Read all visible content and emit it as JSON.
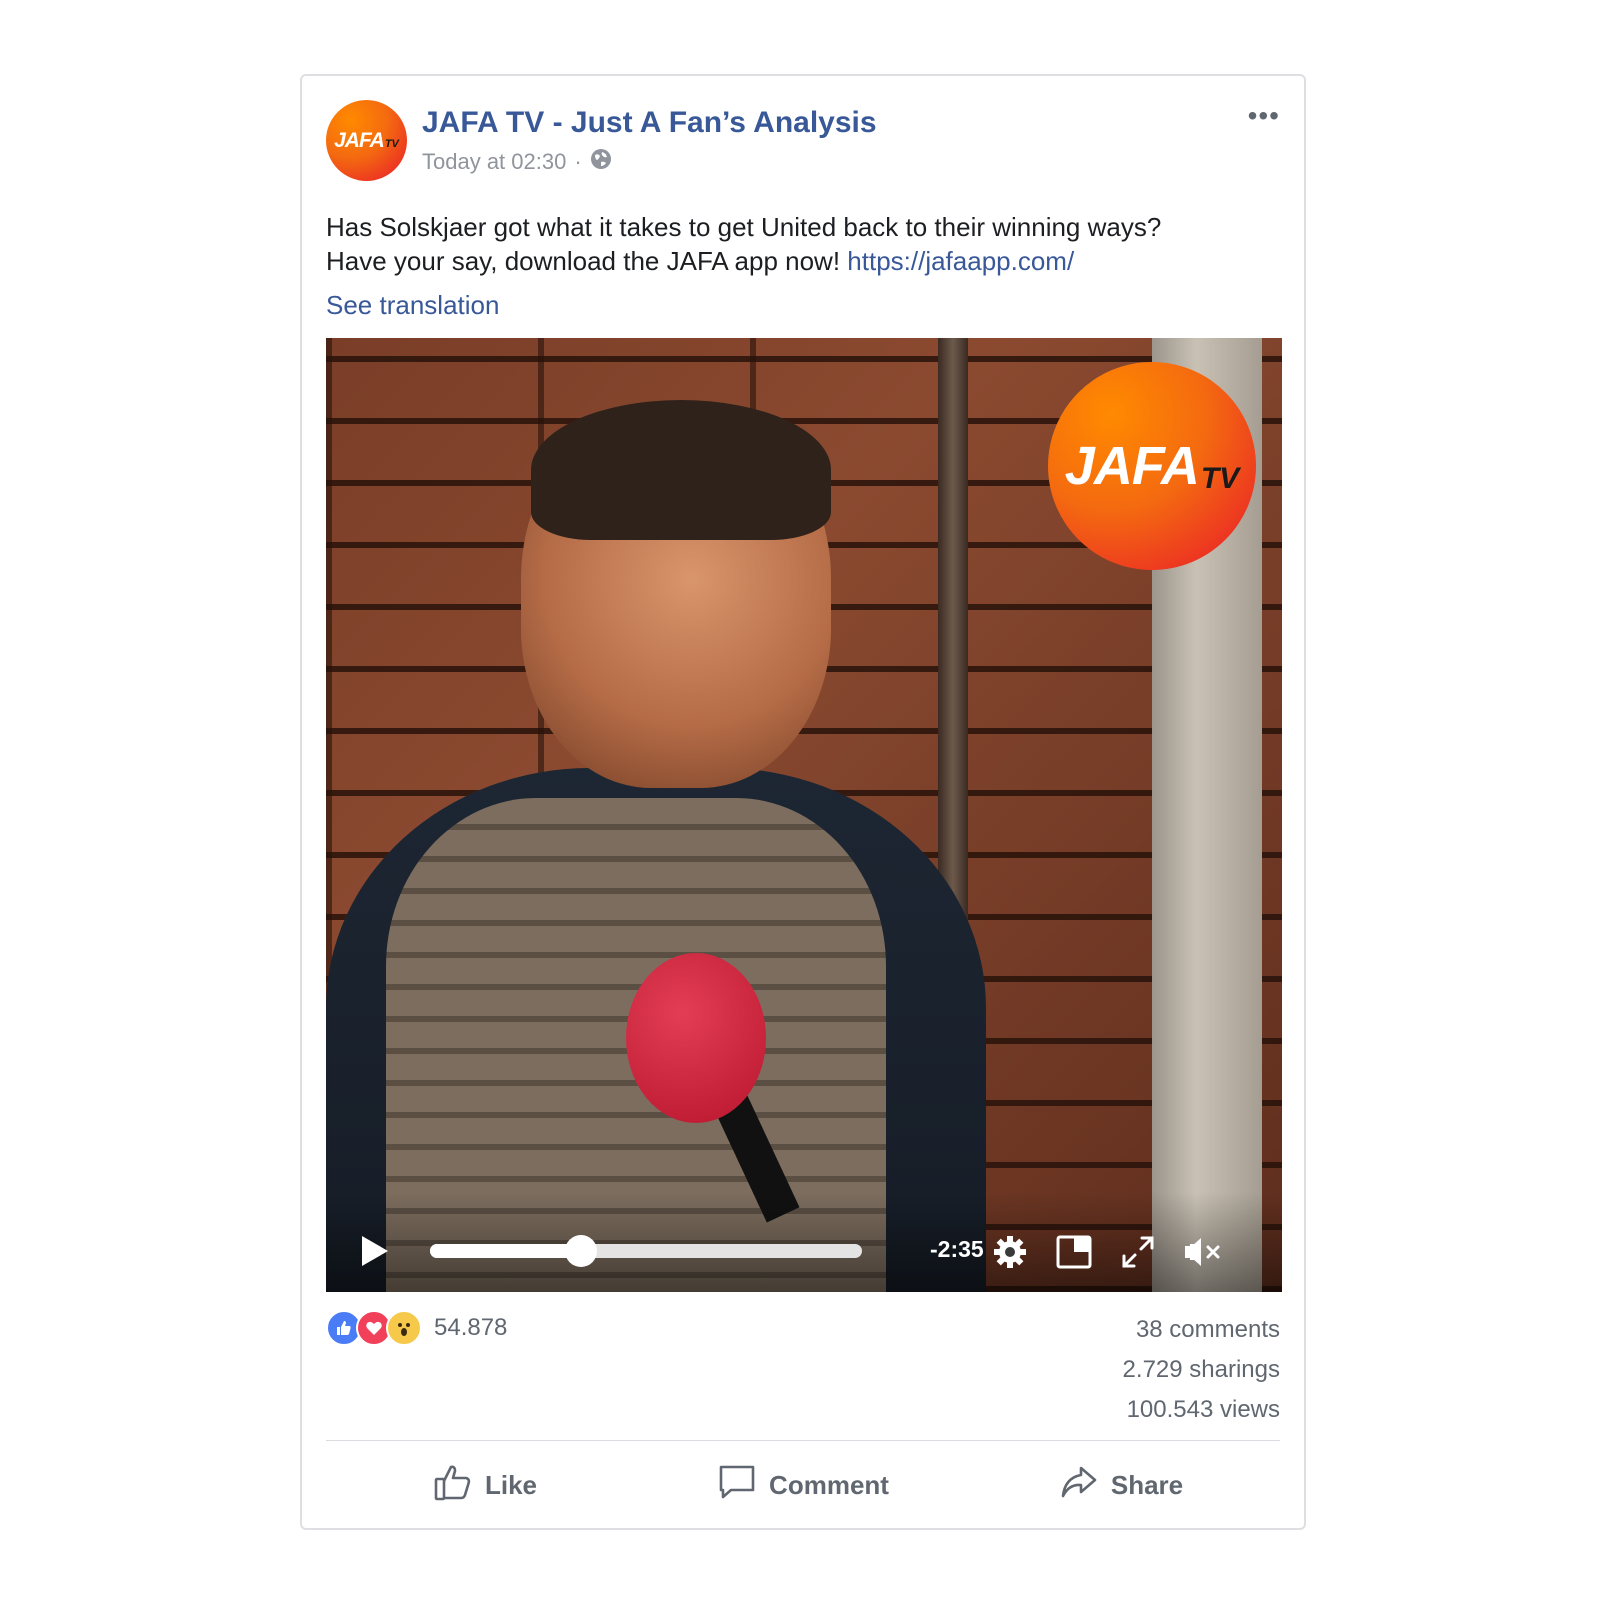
{
  "post": {
    "page_name": "JAFA TV - Just A Fan’s Analysis",
    "timestamp": "Today at 02:30",
    "meta_separator": "·",
    "more_label": "•••",
    "text_line1": "Has Solskjaer got what it takes to get United back to their winning ways?",
    "text_line2": "Have your say, download the JAFA app now!",
    "link": "https://jafaapp.com/",
    "see_translation": "See translation"
  },
  "logo": {
    "word": "JAFA",
    "tv": "TV"
  },
  "video": {
    "time_remaining": "-2:35",
    "progress_fraction": 0.35,
    "muted": true
  },
  "stats": {
    "reaction_count": "54.878",
    "comments": "38 comments",
    "sharings": "2.729 sharings",
    "views": "100.543 views"
  },
  "actions": {
    "like": "Like",
    "comment": "Comment",
    "share": "Share"
  },
  "colors": {
    "link_blue": "#385898",
    "meta_gray": "#90949c",
    "like_blue": "#4a7cf5",
    "love_red": "#f0405a",
    "wow_yellow": "#f7c94a",
    "brand_orange": "#f46a10",
    "brand_red": "#e8162c"
  }
}
